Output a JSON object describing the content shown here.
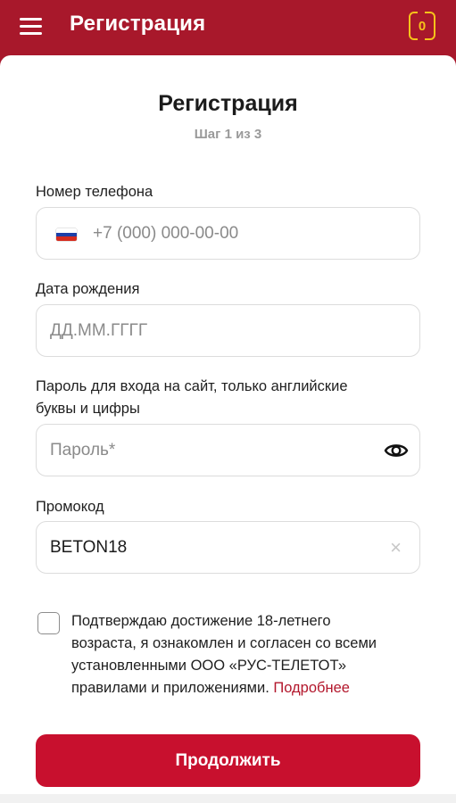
{
  "header": {
    "title": "Регистрация",
    "coupon_count": "0"
  },
  "page": {
    "title": "Регистрация",
    "step": "Шаг 1 из 3"
  },
  "form": {
    "phone": {
      "label": "Номер телефона",
      "placeholder": "+7 (000) 000-00-00",
      "country_flag": "russia-flag-icon"
    },
    "birthdate": {
      "label": "Дата рождения",
      "placeholder": "ДД.ММ.ГГГГ"
    },
    "password": {
      "label_line1": "Пароль для входа на сайт, только английские",
      "label_line2": "буквы и цифры",
      "placeholder": "Пароль*",
      "icon": "eye-icon"
    },
    "promo": {
      "label": "Промокод",
      "value": "BETON18",
      "clear_icon": "×"
    },
    "agreement": {
      "line1": "Подтверждаю достижение 18-летнего",
      "line2": "возраста, я ознакомлен и согласен со всеми",
      "line3": "установленными ООО «РУС-ТЕЛЕТОТ»",
      "line4": "правилами и приложениями.",
      "link": "Подробнее",
      "checked": false
    },
    "submit_label": "Продолжить"
  },
  "colors": {
    "brand": "#a8182b",
    "button": "#c8102e",
    "link": "#b3172c",
    "coupon": "#f6c21a"
  }
}
